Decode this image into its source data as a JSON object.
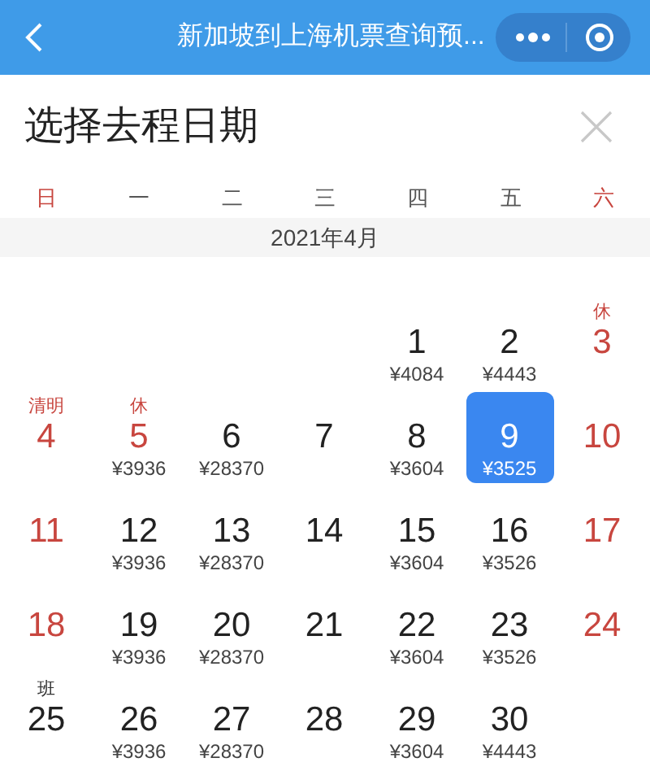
{
  "nav_bar": {
    "title": "新加坡到上海机票查询预..."
  },
  "sheet": {
    "title": "选择去程日期"
  },
  "weekdays": [
    {
      "label": "日",
      "weekend": true
    },
    {
      "label": "一",
      "weekend": false
    },
    {
      "label": "二",
      "weekend": false
    },
    {
      "label": "三",
      "weekend": false
    },
    {
      "label": "四",
      "weekend": false
    },
    {
      "label": "五",
      "weekend": false
    },
    {
      "label": "六",
      "weekend": true
    }
  ],
  "month": "2021年4月",
  "weeks": [
    [
      {
        "day": "1",
        "price": "¥4084",
        "holiday": false,
        "selected": false
      },
      {
        "day": "2",
        "price": "¥4443",
        "holiday": false,
        "selected": false
      },
      {
        "day": "3",
        "tag": {
          "text": "休",
          "kind": "rest"
        },
        "holiday": true,
        "selected": false
      }
    ],
    [
      {
        "day": "4",
        "tag": {
          "text": "清明",
          "kind": "rest"
        },
        "holiday": true,
        "selected": false
      },
      {
        "day": "5",
        "tag": {
          "text": "休",
          "kind": "rest"
        },
        "price": "¥3936",
        "holiday": true,
        "selected": false
      },
      {
        "day": "6",
        "price": "¥28370",
        "holiday": false,
        "selected": false
      },
      {
        "day": "7",
        "holiday": false,
        "selected": false
      },
      {
        "day": "8",
        "price": "¥3604",
        "holiday": false,
        "selected": false
      },
      {
        "day": "9",
        "price": "¥3525",
        "selected": true
      },
      {
        "day": "10",
        "holiday": true,
        "selected": false
      }
    ],
    [
      {
        "day": "11",
        "holiday": true,
        "selected": false
      },
      {
        "day": "12",
        "price": "¥3936",
        "holiday": false,
        "selected": false
      },
      {
        "day": "13",
        "price": "¥28370",
        "holiday": false,
        "selected": false
      },
      {
        "day": "14",
        "holiday": false,
        "selected": false
      },
      {
        "day": "15",
        "price": "¥3604",
        "holiday": false,
        "selected": false
      },
      {
        "day": "16",
        "price": "¥3526",
        "holiday": false,
        "selected": false
      },
      {
        "day": "17",
        "holiday": true,
        "selected": false
      }
    ],
    [
      {
        "day": "18",
        "holiday": true,
        "selected": false
      },
      {
        "day": "19",
        "price": "¥3936",
        "holiday": false,
        "selected": false
      },
      {
        "day": "20",
        "price": "¥28370",
        "holiday": false,
        "selected": false
      },
      {
        "day": "21",
        "holiday": false,
        "selected": false
      },
      {
        "day": "22",
        "price": "¥3604",
        "holiday": false,
        "selected": false
      },
      {
        "day": "23",
        "price": "¥3526",
        "holiday": false,
        "selected": false
      },
      {
        "day": "24",
        "holiday": true,
        "selected": false
      }
    ],
    [
      {
        "day": "25",
        "tag": {
          "text": "班",
          "kind": "work"
        },
        "holiday": false,
        "selected": false
      },
      {
        "day": "26",
        "price": "¥3936",
        "holiday": false,
        "selected": false
      },
      {
        "day": "27",
        "price": "¥28370",
        "holiday": false,
        "selected": false
      },
      {
        "day": "28",
        "holiday": false,
        "selected": false
      },
      {
        "day": "29",
        "price": "¥3604",
        "holiday": false,
        "selected": false
      },
      {
        "day": "30",
        "price": "¥4443",
        "holiday": false,
        "selected": false
      }
    ]
  ]
}
